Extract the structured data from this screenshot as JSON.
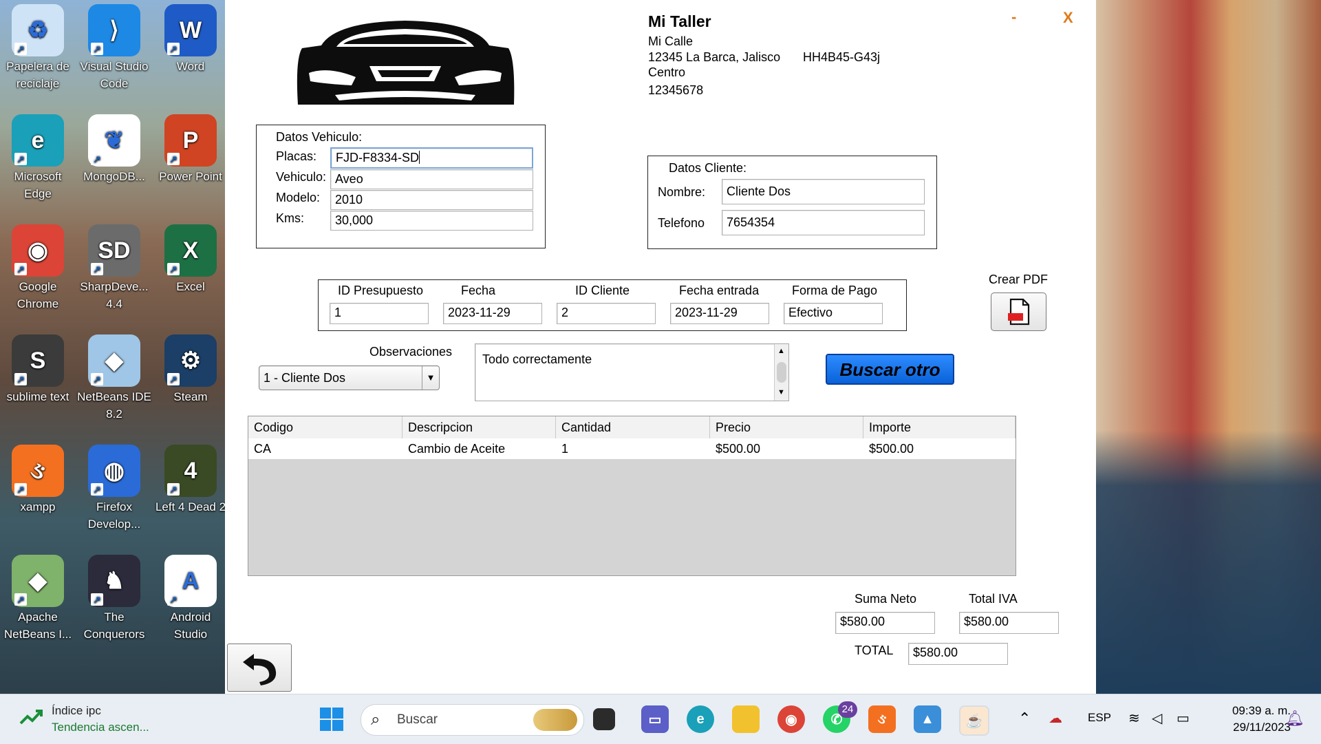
{
  "desktop": {
    "icons": [
      {
        "label": "Papelera de reciclaje",
        "glyph": "♻",
        "color": "#cfe3f7"
      },
      {
        "label": "Visual Studio Code",
        "glyph": "⟩",
        "color": "#1e88e5"
      },
      {
        "label": "Word",
        "glyph": "W",
        "color": "#1f5bc6"
      },
      {
        "label": "Microsoft Edge",
        "glyph": "e",
        "color": "#1aa0b8"
      },
      {
        "label": "MongoDB...",
        "glyph": "❦",
        "color": "#ffffff"
      },
      {
        "label": "Power Point",
        "glyph": "P",
        "color": "#d04423"
      },
      {
        "label": "Google Chrome",
        "glyph": "◉",
        "color": "#db4437"
      },
      {
        "label": "SharpDeve... 4.4",
        "glyph": "SD",
        "color": "#6b6b6b"
      },
      {
        "label": "Excel",
        "glyph": "X",
        "color": "#1d7044"
      },
      {
        "label": "sublime text",
        "glyph": "S",
        "color": "#3b3b3b"
      },
      {
        "label": "NetBeans IDE 8.2",
        "glyph": "◆",
        "color": "#9fc6e6"
      },
      {
        "label": "Steam",
        "glyph": "⚙",
        "color": "#1b3f66"
      },
      {
        "label": "xampp",
        "glyph": "ઙ",
        "color": "#f37021"
      },
      {
        "label": "Firefox Develop...",
        "glyph": "◍",
        "color": "#2a6bd8"
      },
      {
        "label": "Left 4 Dead 2",
        "glyph": "4",
        "color": "#3a4a24"
      },
      {
        "label": "Apache NetBeans I...",
        "glyph": "◆",
        "color": "#7fb26a"
      },
      {
        "label": "The Conquerors",
        "glyph": "♞",
        "color": "#2b2b3b"
      },
      {
        "label": "Android Studio",
        "glyph": "A",
        "color": "#ffffff"
      }
    ]
  },
  "window": {
    "minimize": "-",
    "close": "X"
  },
  "business": {
    "name": "Mi Taller",
    "street": "Mi Calle",
    "city": "12345  La Barca, Jalisco",
    "code": "HH4B45-G43j",
    "colonia": "Centro",
    "phone": "12345678"
  },
  "vehiculo": {
    "title": "Datos Vehiculo:",
    "placas_label": "Placas:",
    "placas": "FJD-F8334-SD",
    "vehiculo_label": "Vehiculo:",
    "vehiculo": "Aveo",
    "modelo_label": "Modelo:",
    "modelo": "2010",
    "kms_label": "Kms:",
    "kms": "30,000"
  },
  "cliente": {
    "title": "Datos Cliente:",
    "nombre_label": "Nombre:",
    "nombre": "Cliente Dos",
    "telefono_label": "Telefono",
    "telefono": "7654354"
  },
  "presupuesto": {
    "headers": [
      "ID Presupuesto",
      "Fecha",
      "ID Cliente",
      "Fecha entrada",
      "Forma de Pago"
    ],
    "values": [
      "1",
      "2023-11-29",
      "2",
      "2023-11-29",
      "Efectivo"
    ]
  },
  "pdf": {
    "label": "Crear PDF",
    "icon_text": "PDF"
  },
  "observaciones": {
    "label": "Observaciones",
    "combo_value": "1 - Cliente Dos",
    "text": "Todo correctamente"
  },
  "buscar": {
    "label": "Buscar otro"
  },
  "table": {
    "columns": [
      "Codigo",
      "Descripcion",
      "Cantidad",
      "Precio",
      "Importe"
    ],
    "rows": [
      [
        "CA",
        "Cambio de Aceite",
        "1",
        "$500.00",
        "$500.00"
      ]
    ]
  },
  "totales": {
    "suma_label": "Suma Neto",
    "suma": "$580.00",
    "iva_label": "Total IVA",
    "iva": "$580.00",
    "total_label": "TOTAL",
    "total": "$580.00"
  },
  "taskbar": {
    "widget_title": "Índice ipc",
    "widget_sub": "Tendencia ascen...",
    "search_placeholder": "Buscar",
    "whatsapp_badge": "24",
    "lang": "ESP",
    "time": "09:39 a. m.",
    "date": "29/11/2023"
  }
}
